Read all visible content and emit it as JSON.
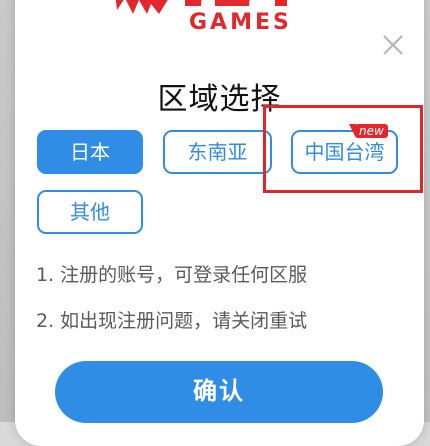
{
  "logo": {
    "brand_text": "RIOT",
    "sub_text": "GAMES"
  },
  "dialog": {
    "title": "区域选择",
    "close_icon": "close-icon",
    "regions": [
      {
        "label": "日本",
        "selected": true
      },
      {
        "label": "东南亚",
        "selected": false
      },
      {
        "label": "中国台湾",
        "selected": false,
        "badge": "new"
      },
      {
        "label": "其他",
        "selected": false
      }
    ],
    "notes": [
      "1. 注册的账号，可登录任何区服",
      "2. 如出现注册问题，请关闭重试"
    ],
    "confirm_label": "确认"
  },
  "colors": {
    "accent": "#2f8de6",
    "brand_red": "#e2282d",
    "annotation_red": "#e0262b"
  }
}
